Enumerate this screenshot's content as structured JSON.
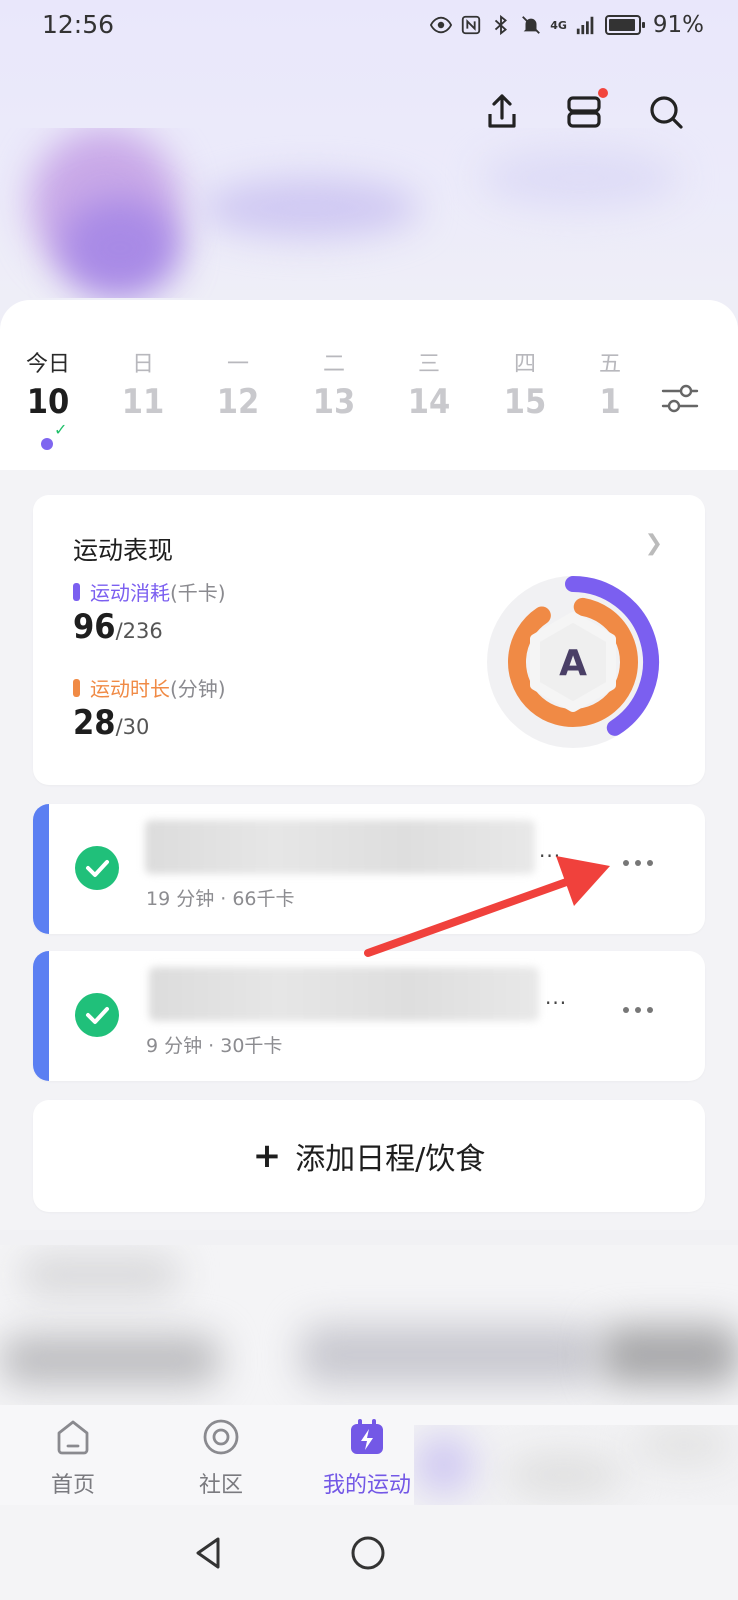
{
  "status_bar": {
    "time": "12:56",
    "network": "4G",
    "battery": "91%"
  },
  "header": {
    "icons": [
      "share-icon",
      "device-icon",
      "search-icon"
    ]
  },
  "calendar": {
    "days": [
      {
        "weekday": "今日",
        "date": "10",
        "today": true
      },
      {
        "weekday": "日",
        "date": "11"
      },
      {
        "weekday": "一",
        "date": "12"
      },
      {
        "weekday": "二",
        "date": "13"
      },
      {
        "weekday": "三",
        "date": "14"
      },
      {
        "weekday": "四",
        "date": "15"
      },
      {
        "weekday": "五",
        "date": "1"
      }
    ]
  },
  "performance": {
    "title": "运动表现",
    "grade": "A",
    "calories": {
      "label": "运动消耗",
      "unit": "(千卡)",
      "value": "96",
      "target": "/236",
      "color": "#7b5ff0"
    },
    "duration": {
      "label": "运动时长",
      "unit": "(分钟)",
      "value": "28",
      "target": "/30",
      "color": "#f08a45"
    },
    "calories_progress": 0.41,
    "duration_progress": 0.93
  },
  "tasks": [
    {
      "subtitle": "19 分钟 · 66千卡",
      "ellipsis": "···"
    },
    {
      "subtitle": "9 分钟 · 30千卡",
      "ellipsis": "···"
    }
  ],
  "add_button": {
    "plus": "+",
    "label": "添加日程/饮食"
  },
  "tabs": [
    {
      "label": "首页"
    },
    {
      "label": "社区"
    },
    {
      "label": "我的运动"
    }
  ],
  "colors": {
    "accent": "#7358e6",
    "task_accent": "#5b7ff2",
    "done_green": "#20c07a",
    "arrow_red": "#f0413c"
  }
}
